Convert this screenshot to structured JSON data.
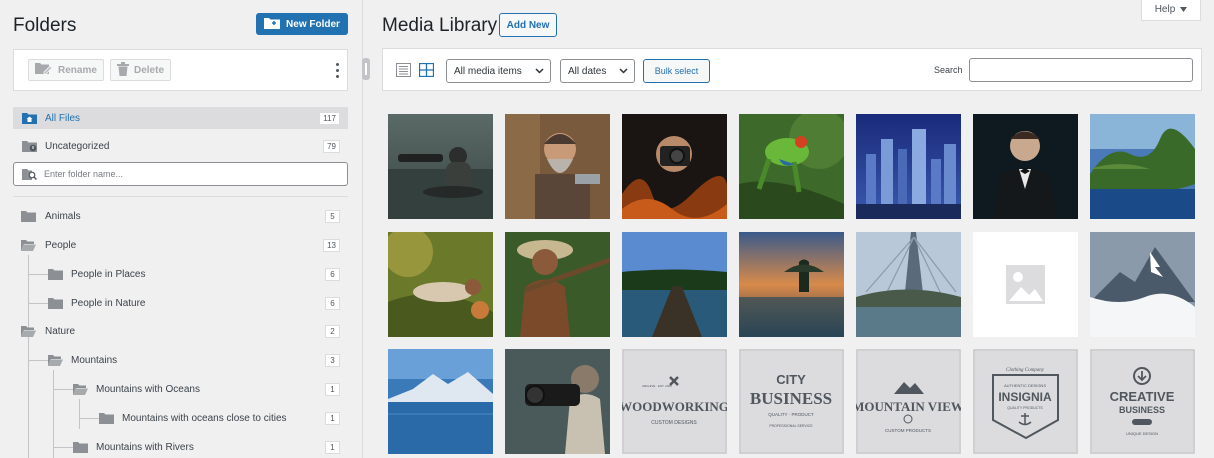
{
  "folders_panel": {
    "title": "Folders",
    "new_folder_label": "New Folder",
    "rename_label": "Rename",
    "delete_label": "Delete",
    "search_placeholder": "Enter folder name...",
    "all_files": {
      "label": "All Files",
      "count": "117"
    },
    "uncategorized": {
      "label": "Uncategorized",
      "count": "79"
    },
    "tree": [
      {
        "label": "Animals",
        "count": "5"
      },
      {
        "label": "People",
        "count": "13"
      },
      {
        "label": "People in Places",
        "count": "6"
      },
      {
        "label": "People in Nature",
        "count": "6"
      },
      {
        "label": "Nature",
        "count": "2"
      },
      {
        "label": "Mountains",
        "count": "3"
      },
      {
        "label": "Mountains with Oceans",
        "count": "1"
      },
      {
        "label": "Mountains with oceans close to cities",
        "count": "1"
      },
      {
        "label": "Mountains with Rivers",
        "count": "1"
      }
    ]
  },
  "media_library": {
    "title": "Media Library",
    "add_new_label": "Add New",
    "help_label": "Help",
    "filters": {
      "media_type": "All media items",
      "dates": "All dates",
      "bulk_select_label": "Bulk select",
      "search_label": "Search"
    },
    "logos": [
      {
        "line1": "WOODWORKING",
        "line2": "CUSTOM DESIGNS",
        "small": "ARCHIVE · EST. 2020"
      },
      {
        "line1": "CITY",
        "line2": "BUSINESS",
        "small": "QUALITY · PRODUCT",
        "small2": "PROFESSIONAL SERVICE"
      },
      {
        "line1": "MOUNTAIN VIEW",
        "line2": "CUSTOM PRODUCTS"
      },
      {
        "line1": "INSIGNIA",
        "line2": "QUALITY PRODUCTS",
        "small": "Clothing Company",
        "small2": "AUTHENTIC DESIGNS"
      },
      {
        "line1": "CREATIVE",
        "line2": "BUSINESS",
        "small": "UNIQUE DESIGN"
      }
    ]
  },
  "colors": {
    "accent": "#2271b1",
    "panel_bg": "#f0f0f1",
    "border": "#dcdcde"
  }
}
